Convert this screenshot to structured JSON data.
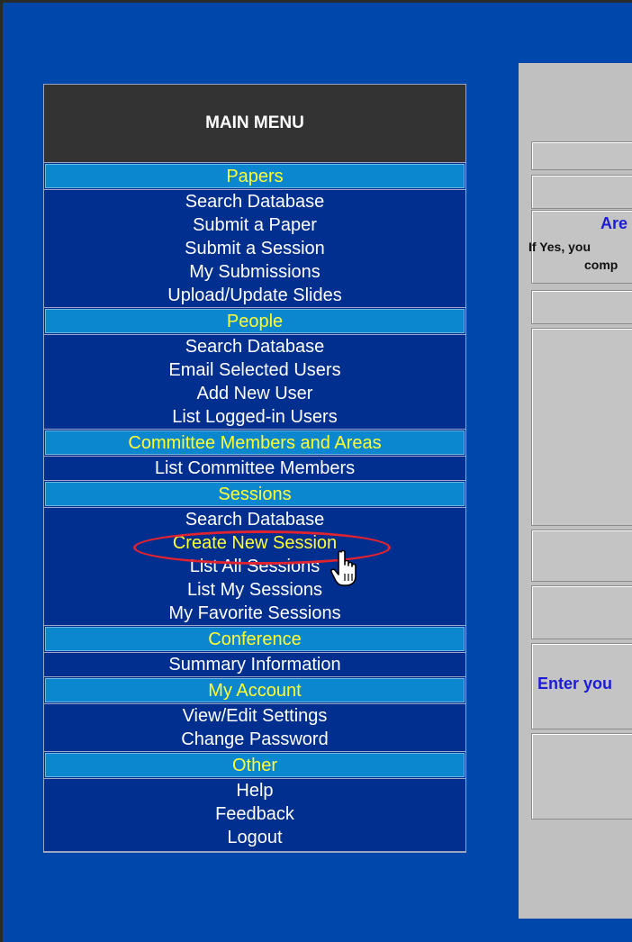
{
  "menu": {
    "title": "MAIN MENU",
    "sections": [
      {
        "heading": "Papers",
        "items": [
          "Search Database",
          "Submit a Paper",
          "Submit a Session",
          "My Submissions",
          "Upload/Update Slides"
        ]
      },
      {
        "heading": "People",
        "items": [
          "Search Database",
          "Email Selected Users",
          "Add New User",
          "List Logged-in Users"
        ]
      },
      {
        "heading": "Committee Members and Areas",
        "items": [
          "List Committee Members"
        ]
      },
      {
        "heading": "Sessions",
        "items": [
          "Search Database",
          "Create New Session",
          "List All Sessions",
          "List My Sessions",
          "My Favorite Sessions"
        ]
      },
      {
        "heading": "Conference",
        "items": [
          "Summary Information"
        ]
      },
      {
        "heading": "My Account",
        "items": [
          "View/Edit Settings",
          "Change Password"
        ]
      },
      {
        "heading": "Other",
        "items": [
          "Help",
          "Feedback",
          "Logout"
        ]
      }
    ]
  },
  "content": {
    "question_partial": "Are",
    "note_line1": "If Yes, you",
    "note_line2": "comp",
    "enter_partial": "Enter you"
  },
  "colors": {
    "background_blue": "#0047ab",
    "menu_blue": "#002f8f",
    "section_blue": "#0b87d0",
    "section_text": "#ffff33",
    "highlight_ring": "#e0232e"
  },
  "icons": {
    "cursor": "hand-pointer-icon"
  }
}
